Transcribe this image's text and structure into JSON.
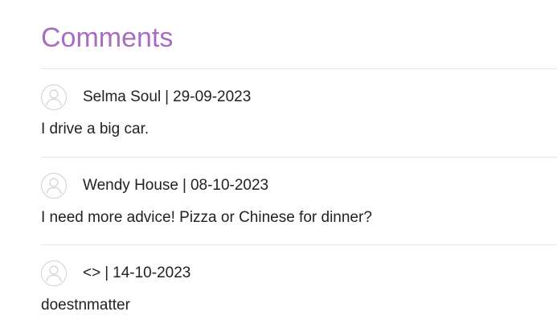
{
  "section": {
    "title": "Comments"
  },
  "comments": [
    {
      "author": "Selma Soul",
      "separator": "|",
      "date": "29-09-2023",
      "text": "I drive a big car."
    },
    {
      "author": "Wendy House",
      "separator": "|",
      "date": "08-10-2023",
      "text": "I need more advice! Pizza or Chinese for dinner?"
    },
    {
      "author": "<>",
      "separator": "|",
      "date": "14-10-2023",
      "text": "doestnmatter"
    }
  ],
  "colors": {
    "heading": "#a86cc1",
    "divider": "#e6e6e6",
    "text": "#222222",
    "avatar": "#d0d0d0"
  },
  "icons": {
    "avatar": "user-avatar-icon"
  }
}
